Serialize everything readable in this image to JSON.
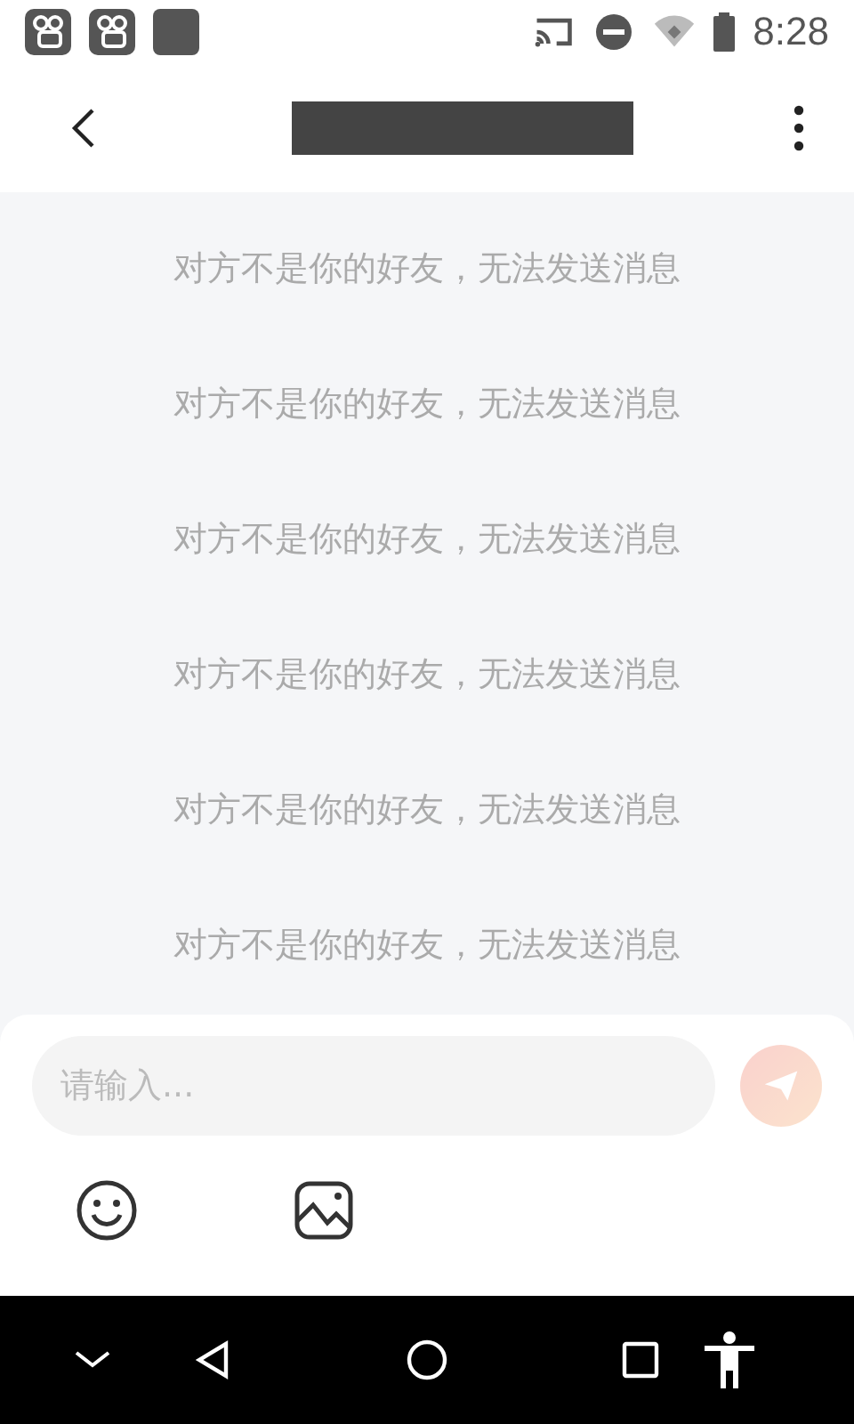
{
  "status_bar": {
    "time": "8:28"
  },
  "messages": [
    {
      "text": "对方不是你的好友，无法发送消息"
    },
    {
      "text": "对方不是你的好友，无法发送消息"
    },
    {
      "text": "对方不是你的好友，无法发送消息"
    },
    {
      "text": "对方不是你的好友，无法发送消息"
    },
    {
      "text": "对方不是你的好友，无法发送消息"
    },
    {
      "text": "对方不是你的好友，无法发送消息"
    }
  ],
  "composer": {
    "placeholder": "请输入...",
    "send_disabled": true
  }
}
